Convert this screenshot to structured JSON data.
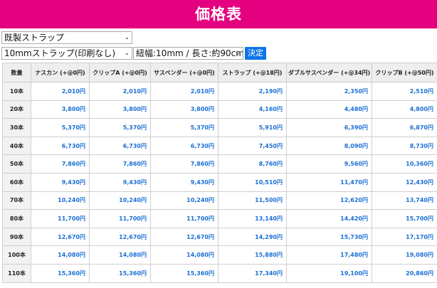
{
  "page": {
    "title": "価格表"
  },
  "controls": {
    "category_select": "既製ストラップ",
    "product_select": "10mmストラップ(印刷なし)",
    "spec_select": "紐幅:10mm / 長さ:約90cm",
    "submit_label": "決定"
  },
  "table": {
    "headers": [
      "数量",
      "ナスカン (+@0円)",
      "クリップA (+@0円)",
      "サスペンダー (+@0円)",
      "ストラップ (+@18円)",
      "ダブルサスペンダー (+@34円)",
      "クリップB (+@50円)"
    ],
    "rows": [
      {
        "qty": "10本",
        "values": [
          "2,010円",
          "2,010円",
          "2,010円",
          "2,190円",
          "2,350円",
          "2,510円"
        ]
      },
      {
        "qty": "20本",
        "values": [
          "3,800円",
          "3,800円",
          "3,800円",
          "4,160円",
          "4,480円",
          "4,800円"
        ]
      },
      {
        "qty": "30本",
        "values": [
          "5,370円",
          "5,370円",
          "5,370円",
          "5,910円",
          "6,390円",
          "6,870円"
        ]
      },
      {
        "qty": "40本",
        "values": [
          "6,730円",
          "6,730円",
          "6,730円",
          "7,450円",
          "8,090円",
          "8,730円"
        ]
      },
      {
        "qty": "50本",
        "values": [
          "7,860円",
          "7,860円",
          "7,860円",
          "8,760円",
          "9,560円",
          "10,360円"
        ]
      },
      {
        "qty": "60本",
        "values": [
          "9,430円",
          "9,430円",
          "9,430円",
          "10,510円",
          "11,470円",
          "12,430円"
        ]
      },
      {
        "qty": "70本",
        "values": [
          "10,240円",
          "10,240円",
          "10,240円",
          "11,500円",
          "12,620円",
          "13,740円"
        ]
      },
      {
        "qty": "80本",
        "values": [
          "11,700円",
          "11,700円",
          "11,700円",
          "13,140円",
          "14,420円",
          "15,700円"
        ]
      },
      {
        "qty": "90本",
        "values": [
          "12,670円",
          "12,670円",
          "12,670円",
          "14,290円",
          "15,730円",
          "17,170円"
        ]
      },
      {
        "qty": "100本",
        "values": [
          "14,080円",
          "14,080円",
          "14,080円",
          "15,880円",
          "17,480円",
          "19,080円"
        ]
      },
      {
        "qty": "110本",
        "values": [
          "15,360円",
          "15,360円",
          "15,360円",
          "17,340円",
          "19,100円",
          "20,860円"
        ]
      }
    ]
  }
}
